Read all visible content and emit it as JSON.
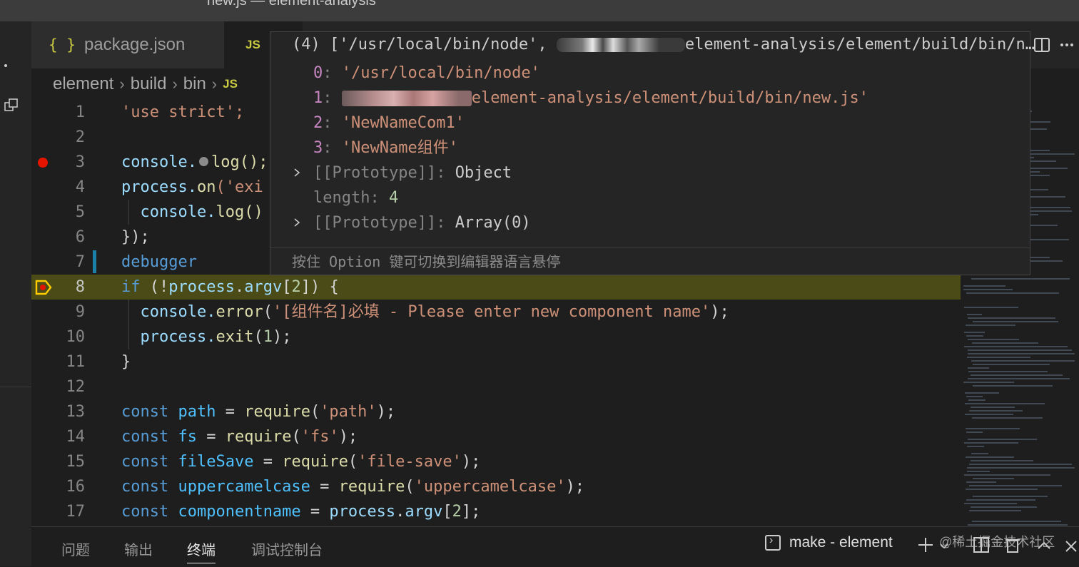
{
  "window": {
    "title": "new.js — element-analysis"
  },
  "tabs": [
    {
      "label": "package.json",
      "icon": "braces-icon"
    },
    {
      "label": "JS",
      "icon": "js-icon"
    }
  ],
  "breadcrumb": [
    "element",
    "build",
    "bin",
    "JS"
  ],
  "hover": {
    "header": "(4) ['/usr/local/bin/node', ",
    "header_tail": "element-analysis/element/build/bin/n…",
    "items": [
      {
        "key": "0",
        "value": "'/usr/local/bin/node'"
      },
      {
        "key": "1",
        "value": "element-analysis/element/build/bin/new.js'"
      },
      {
        "key": "2",
        "value": "'NewNameCom1'"
      },
      {
        "key": "3",
        "value": "'NewName组件'"
      }
    ],
    "proto1_key": "[[Prototype]]",
    "proto1_val": "Object",
    "length_key": "length",
    "length_val": "4",
    "proto2_key": "[[Prototype]]",
    "proto2_val": "Array(0)",
    "hint_a": "按住 ",
    "hint_b": "Option",
    "hint_c": " 键可切换到编辑器语言悬停"
  },
  "line_numbers": [
    "1",
    "2",
    "3",
    "4",
    "5",
    "6",
    "7",
    "8",
    "9",
    "10",
    "11",
    "12",
    "13",
    "14",
    "15",
    "16",
    "17"
  ],
  "code": {
    "l1": "'use strict';",
    "l3a": "console.",
    "l3b": "log();",
    "l4a": "process.",
    "l4b": "on",
    "l4c": "('exi",
    "l5a": "console.",
    "l5b": "log()",
    "l6": "});",
    "l7": "debugger",
    "l8a": "if",
    "l8b": " (!",
    "l8c": "process",
    "l8d": ".",
    "l8e": "argv",
    "l8f": "[",
    "l8g": "2",
    "l8h": "]) {",
    "l9a": "console.",
    "l9b": "error",
    "l9c": "(",
    "l9d": "'[组件名]必填 - Please enter new component name'",
    "l9e": ");",
    "l10a": "process.",
    "l10b": "exit",
    "l10c": "(",
    "l10d": "1",
    "l10e": ");",
    "l11": "}",
    "l13a": "const",
    "l13b": "path",
    "l13c": " = ",
    "l13d": "require",
    "l13e": "(",
    "l13f": "'path'",
    "l13g": ");",
    "l14a": "const",
    "l14b": "fs",
    "l14c": " = ",
    "l14d": "require",
    "l14e": "(",
    "l14f": "'fs'",
    "l14g": ");",
    "l15a": "const",
    "l15b": "fileSave",
    "l15c": " = ",
    "l15d": "require",
    "l15e": "(",
    "l15f": "'file-save'",
    "l15g": ");",
    "l16a": "const",
    "l16b": "uppercamelcase",
    "l16c": " = ",
    "l16d": "require",
    "l16e": "(",
    "l16f": "'uppercamelcase'",
    "l16g": ");",
    "l17a": "const",
    "l17b": "componentname",
    "l17c": " = ",
    "l17d": "process",
    "l17e": ".",
    "l17f": "argv",
    "l17g": "[",
    "l17h": "2",
    "l17i": "];"
  },
  "panel": {
    "tabs": [
      "问题",
      "输出",
      "终端",
      "调试控制台"
    ],
    "active_tab": "终端",
    "terminal_name": "make - element"
  },
  "watermark": "@稀土掘金技术社区",
  "colors": {
    "accent_highlight": "#4b4b18",
    "breakpoint": "#e51400",
    "current_line_arrow": "#ffcc00"
  }
}
